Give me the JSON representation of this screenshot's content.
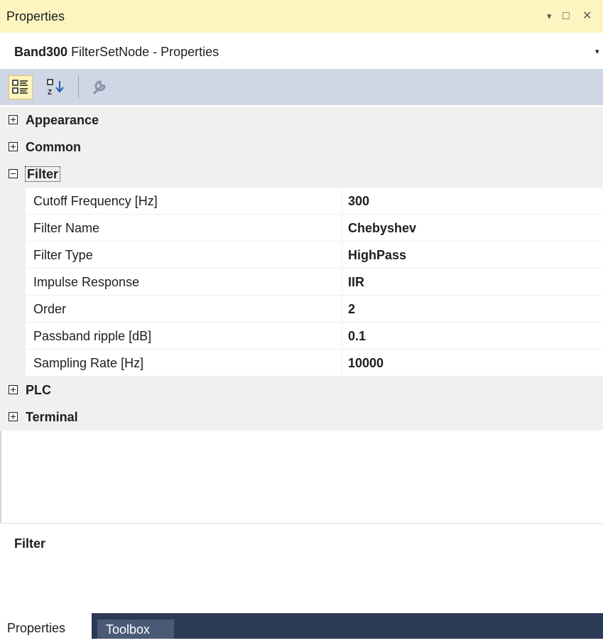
{
  "window": {
    "title": "Properties",
    "dropdown_glyph": "▾",
    "maximize_glyph": "□",
    "close_glyph": "✕"
  },
  "object_selector": {
    "object_name": "Band300",
    "object_type": "FilterSetNode - Properties",
    "dropdown_glyph": "▾"
  },
  "toolbar": {
    "buttons": [
      {
        "name": "categorized",
        "icon": "categorized-icon",
        "selected": true
      },
      {
        "name": "alphabetical",
        "icon": "sort-az-icon",
        "selected": false
      },
      {
        "name": "property-pages",
        "icon": "wrench-icon",
        "selected": false,
        "enabled": false
      }
    ]
  },
  "grid": {
    "categories": [
      {
        "label": "Appearance",
        "expanded": false
      },
      {
        "label": "Common",
        "expanded": false
      },
      {
        "label": "Filter",
        "expanded": true
      },
      {
        "label": "PLC",
        "expanded": false
      },
      {
        "label": "Terminal",
        "expanded": false
      }
    ],
    "filter_properties": [
      {
        "name": "Cutoff Frequency [Hz]",
        "value": "300"
      },
      {
        "name": "Filter Name",
        "value": "Chebyshev"
      },
      {
        "name": "Filter Type",
        "value": "HighPass"
      },
      {
        "name": "Impulse Response",
        "value": "IIR"
      },
      {
        "name": "Order",
        "value": "2"
      },
      {
        "name": "Passband ripple [dB]",
        "value": "0.1"
      },
      {
        "name": "Sampling Rate [Hz]",
        "value": "10000"
      }
    ]
  },
  "description": {
    "title": "Filter"
  },
  "tabs": [
    {
      "label": "Properties",
      "active": true
    },
    {
      "label": "Toolbox",
      "active": false
    }
  ],
  "colors": {
    "title_bar": "#fdf4bf",
    "toolbar": "#cfd6e5",
    "category_bg": "#f0f0f0",
    "tab_bar": "#2b3a55"
  }
}
